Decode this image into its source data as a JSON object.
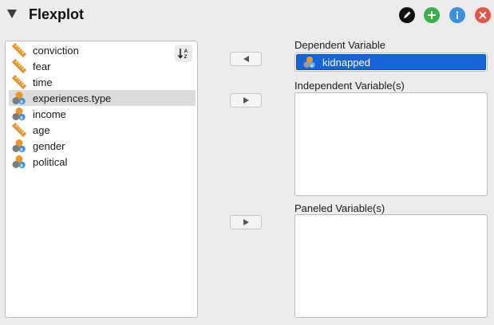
{
  "header": {
    "title": "Flexplot"
  },
  "variables": [
    {
      "label": "conviction",
      "icon": "scale-icon",
      "selected": false
    },
    {
      "label": "fear",
      "icon": "scale-icon",
      "selected": false
    },
    {
      "label": "time",
      "icon": "scale-icon",
      "selected": false
    },
    {
      "label": "experiences.type",
      "icon": "nominal-text-icon",
      "selected": true
    },
    {
      "label": "income",
      "icon": "nominal-text-icon",
      "selected": false
    },
    {
      "label": "age",
      "icon": "scale-icon",
      "selected": false
    },
    {
      "label": "gender",
      "icon": "nominal-text-icon",
      "selected": false
    },
    {
      "label": "political",
      "icon": "nominal-text-icon",
      "selected": false
    }
  ],
  "sort_button": {
    "icon": "sort-icon"
  },
  "dependent": {
    "label": "Dependent Variable",
    "value": "kidnapped",
    "icon": "nominal-text-icon"
  },
  "independent": {
    "label": "Independent Variable(s)",
    "items": []
  },
  "paneled": {
    "label": "Paneled Variable(s)",
    "items": []
  },
  "colors": {
    "accent": "#1565d8",
    "add": "#3ab04a",
    "info": "#3d8fe0",
    "close": "#e45447",
    "selection": "#dcdcdc",
    "scale_icon": "#e8962a"
  }
}
